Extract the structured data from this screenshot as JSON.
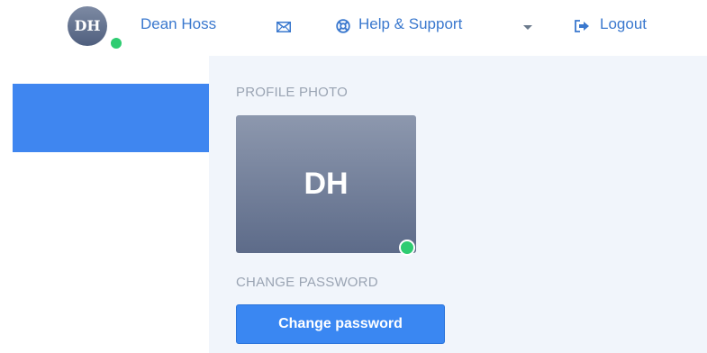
{
  "header": {
    "user": {
      "initials": "DH",
      "name": "Dean Hoss",
      "status": "online"
    },
    "icons": {
      "mail": "mail-icon",
      "help": "lifebuoy-icon",
      "logout": "sign-out-icon"
    },
    "help_label": "Help & Support",
    "logout_label": "Logout",
    "edge_mark": "."
  },
  "sidebar": {
    "active_item_color": "#3f86f0"
  },
  "main": {
    "profile_photo_label": "PROFILE PHOTO",
    "profile_photo_initials": "DH",
    "change_password_label": "CHANGE PASSWORD",
    "change_password_button": "Change password"
  },
  "colors": {
    "link": "#3a78ce",
    "button": "#3a87f2",
    "online": "#2ecc71",
    "content_bg": "#f1f5fb"
  }
}
